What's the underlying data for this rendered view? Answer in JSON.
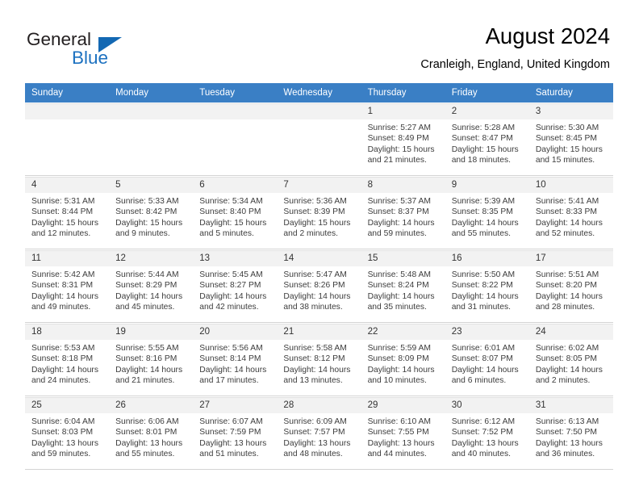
{
  "logo": {
    "word1": "General",
    "word2": "Blue",
    "triangle_color": "#1368b3"
  },
  "header": {
    "title": "August 2024",
    "location": "Cranleigh, England, United Kingdom",
    "header_bg": "#3a7fc5"
  },
  "weekdays": [
    "Sunday",
    "Monday",
    "Tuesday",
    "Wednesday",
    "Thursday",
    "Friday",
    "Saturday"
  ],
  "weeks": [
    [
      {
        "day": "",
        "sunrise": "",
        "sunset": "",
        "daylight1": "",
        "daylight2": ""
      },
      {
        "day": "",
        "sunrise": "",
        "sunset": "",
        "daylight1": "",
        "daylight2": ""
      },
      {
        "day": "",
        "sunrise": "",
        "sunset": "",
        "daylight1": "",
        "daylight2": ""
      },
      {
        "day": "",
        "sunrise": "",
        "sunset": "",
        "daylight1": "",
        "daylight2": ""
      },
      {
        "day": "1",
        "sunrise": "Sunrise: 5:27 AM",
        "sunset": "Sunset: 8:49 PM",
        "daylight1": "Daylight: 15 hours",
        "daylight2": "and 21 minutes."
      },
      {
        "day": "2",
        "sunrise": "Sunrise: 5:28 AM",
        "sunset": "Sunset: 8:47 PM",
        "daylight1": "Daylight: 15 hours",
        "daylight2": "and 18 minutes."
      },
      {
        "day": "3",
        "sunrise": "Sunrise: 5:30 AM",
        "sunset": "Sunset: 8:45 PM",
        "daylight1": "Daylight: 15 hours",
        "daylight2": "and 15 minutes."
      }
    ],
    [
      {
        "day": "4",
        "sunrise": "Sunrise: 5:31 AM",
        "sunset": "Sunset: 8:44 PM",
        "daylight1": "Daylight: 15 hours",
        "daylight2": "and 12 minutes."
      },
      {
        "day": "5",
        "sunrise": "Sunrise: 5:33 AM",
        "sunset": "Sunset: 8:42 PM",
        "daylight1": "Daylight: 15 hours",
        "daylight2": "and 9 minutes."
      },
      {
        "day": "6",
        "sunrise": "Sunrise: 5:34 AM",
        "sunset": "Sunset: 8:40 PM",
        "daylight1": "Daylight: 15 hours",
        "daylight2": "and 5 minutes."
      },
      {
        "day": "7",
        "sunrise": "Sunrise: 5:36 AM",
        "sunset": "Sunset: 8:39 PM",
        "daylight1": "Daylight: 15 hours",
        "daylight2": "and 2 minutes."
      },
      {
        "day": "8",
        "sunrise": "Sunrise: 5:37 AM",
        "sunset": "Sunset: 8:37 PM",
        "daylight1": "Daylight: 14 hours",
        "daylight2": "and 59 minutes."
      },
      {
        "day": "9",
        "sunrise": "Sunrise: 5:39 AM",
        "sunset": "Sunset: 8:35 PM",
        "daylight1": "Daylight: 14 hours",
        "daylight2": "and 55 minutes."
      },
      {
        "day": "10",
        "sunrise": "Sunrise: 5:41 AM",
        "sunset": "Sunset: 8:33 PM",
        "daylight1": "Daylight: 14 hours",
        "daylight2": "and 52 minutes."
      }
    ],
    [
      {
        "day": "11",
        "sunrise": "Sunrise: 5:42 AM",
        "sunset": "Sunset: 8:31 PM",
        "daylight1": "Daylight: 14 hours",
        "daylight2": "and 49 minutes."
      },
      {
        "day": "12",
        "sunrise": "Sunrise: 5:44 AM",
        "sunset": "Sunset: 8:29 PM",
        "daylight1": "Daylight: 14 hours",
        "daylight2": "and 45 minutes."
      },
      {
        "day": "13",
        "sunrise": "Sunrise: 5:45 AM",
        "sunset": "Sunset: 8:27 PM",
        "daylight1": "Daylight: 14 hours",
        "daylight2": "and 42 minutes."
      },
      {
        "day": "14",
        "sunrise": "Sunrise: 5:47 AM",
        "sunset": "Sunset: 8:26 PM",
        "daylight1": "Daylight: 14 hours",
        "daylight2": "and 38 minutes."
      },
      {
        "day": "15",
        "sunrise": "Sunrise: 5:48 AM",
        "sunset": "Sunset: 8:24 PM",
        "daylight1": "Daylight: 14 hours",
        "daylight2": "and 35 minutes."
      },
      {
        "day": "16",
        "sunrise": "Sunrise: 5:50 AM",
        "sunset": "Sunset: 8:22 PM",
        "daylight1": "Daylight: 14 hours",
        "daylight2": "and 31 minutes."
      },
      {
        "day": "17",
        "sunrise": "Sunrise: 5:51 AM",
        "sunset": "Sunset: 8:20 PM",
        "daylight1": "Daylight: 14 hours",
        "daylight2": "and 28 minutes."
      }
    ],
    [
      {
        "day": "18",
        "sunrise": "Sunrise: 5:53 AM",
        "sunset": "Sunset: 8:18 PM",
        "daylight1": "Daylight: 14 hours",
        "daylight2": "and 24 minutes."
      },
      {
        "day": "19",
        "sunrise": "Sunrise: 5:55 AM",
        "sunset": "Sunset: 8:16 PM",
        "daylight1": "Daylight: 14 hours",
        "daylight2": "and 21 minutes."
      },
      {
        "day": "20",
        "sunrise": "Sunrise: 5:56 AM",
        "sunset": "Sunset: 8:14 PM",
        "daylight1": "Daylight: 14 hours",
        "daylight2": "and 17 minutes."
      },
      {
        "day": "21",
        "sunrise": "Sunrise: 5:58 AM",
        "sunset": "Sunset: 8:12 PM",
        "daylight1": "Daylight: 14 hours",
        "daylight2": "and 13 minutes."
      },
      {
        "day": "22",
        "sunrise": "Sunrise: 5:59 AM",
        "sunset": "Sunset: 8:09 PM",
        "daylight1": "Daylight: 14 hours",
        "daylight2": "and 10 minutes."
      },
      {
        "day": "23",
        "sunrise": "Sunrise: 6:01 AM",
        "sunset": "Sunset: 8:07 PM",
        "daylight1": "Daylight: 14 hours",
        "daylight2": "and 6 minutes."
      },
      {
        "day": "24",
        "sunrise": "Sunrise: 6:02 AM",
        "sunset": "Sunset: 8:05 PM",
        "daylight1": "Daylight: 14 hours",
        "daylight2": "and 2 minutes."
      }
    ],
    [
      {
        "day": "25",
        "sunrise": "Sunrise: 6:04 AM",
        "sunset": "Sunset: 8:03 PM",
        "daylight1": "Daylight: 13 hours",
        "daylight2": "and 59 minutes."
      },
      {
        "day": "26",
        "sunrise": "Sunrise: 6:06 AM",
        "sunset": "Sunset: 8:01 PM",
        "daylight1": "Daylight: 13 hours",
        "daylight2": "and 55 minutes."
      },
      {
        "day": "27",
        "sunrise": "Sunrise: 6:07 AM",
        "sunset": "Sunset: 7:59 PM",
        "daylight1": "Daylight: 13 hours",
        "daylight2": "and 51 minutes."
      },
      {
        "day": "28",
        "sunrise": "Sunrise: 6:09 AM",
        "sunset": "Sunset: 7:57 PM",
        "daylight1": "Daylight: 13 hours",
        "daylight2": "and 48 minutes."
      },
      {
        "day": "29",
        "sunrise": "Sunrise: 6:10 AM",
        "sunset": "Sunset: 7:55 PM",
        "daylight1": "Daylight: 13 hours",
        "daylight2": "and 44 minutes."
      },
      {
        "day": "30",
        "sunrise": "Sunrise: 6:12 AM",
        "sunset": "Sunset: 7:52 PM",
        "daylight1": "Daylight: 13 hours",
        "daylight2": "and 40 minutes."
      },
      {
        "day": "31",
        "sunrise": "Sunrise: 6:13 AM",
        "sunset": "Sunset: 7:50 PM",
        "daylight1": "Daylight: 13 hours",
        "daylight2": "and 36 minutes."
      }
    ]
  ]
}
